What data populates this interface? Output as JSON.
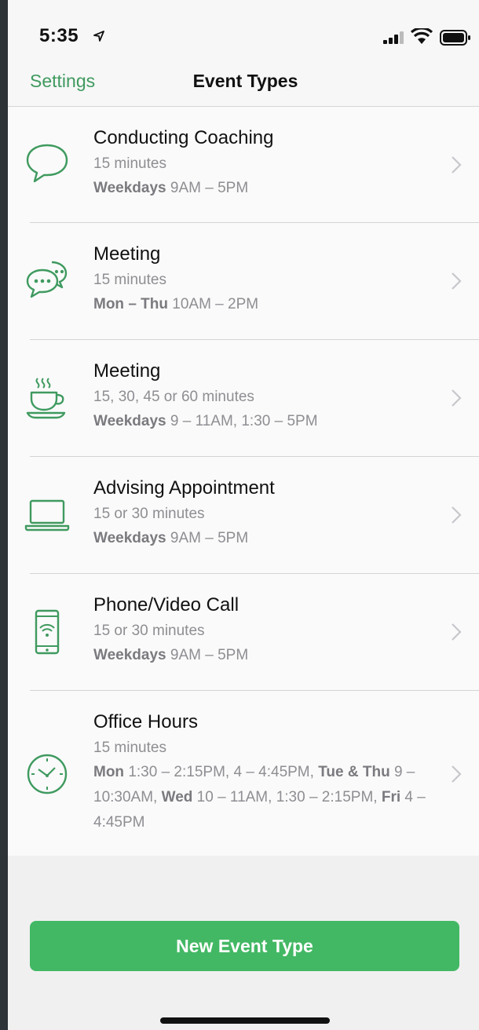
{
  "status": {
    "time": "5:35"
  },
  "nav": {
    "back_label": "Settings",
    "title": "Event Types"
  },
  "events": [
    {
      "icon": "speech-bubble-icon",
      "title": "Conducting Coaching",
      "duration": "15 minutes",
      "hours": [
        {
          "b": "Weekdays",
          "t": " 9AM – 5PM"
        }
      ]
    },
    {
      "icon": "chat-bubbles-icon",
      "title": "Meeting",
      "duration": "15 minutes",
      "hours": [
        {
          "b": "Mon – Thu",
          "t": " 10AM – 2PM"
        }
      ]
    },
    {
      "icon": "coffee-cup-icon",
      "title": "Meeting",
      "duration": "15, 30, 45 or 60 minutes",
      "hours": [
        {
          "b": "Weekdays",
          "t": " 9 – 11AM, 1:30 – 5PM"
        }
      ]
    },
    {
      "icon": "laptop-icon",
      "title": "Advising Appointment",
      "duration": "15 or 30 minutes",
      "hours": [
        {
          "b": "Weekdays",
          "t": " 9AM – 5PM"
        }
      ]
    },
    {
      "icon": "phone-video-icon",
      "title": "Phone/Video Call",
      "duration": "15 or 30 minutes",
      "hours": [
        {
          "b": "Weekdays",
          "t": " 9AM – 5PM"
        }
      ]
    },
    {
      "icon": "clock-icon",
      "title": "Office Hours",
      "duration": "15 minutes",
      "hours": [
        {
          "b": "Mon",
          "t": " 1:30 – 2:15PM, 4 – 4:45PM, "
        },
        {
          "b": "Tue & Thu",
          "t": " 9 – 10:30AM, "
        },
        {
          "b": "Wed",
          "t": " 10 – 11AM, 1:30 – 2:15PM, "
        },
        {
          "b": "Fri",
          "t": " 4 – 4:45PM"
        }
      ]
    }
  ],
  "footer": {
    "new_button_label": "New Event Type"
  },
  "colors": {
    "accent": "#3f9a5f",
    "button": "#43b864"
  }
}
